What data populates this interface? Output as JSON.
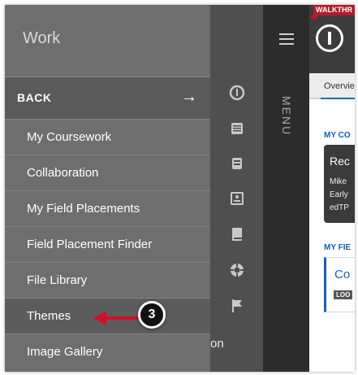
{
  "drawer": {
    "title": "Work",
    "back_label": "BACK",
    "back_arrow": "→",
    "items": [
      {
        "label": "My Coursework"
      },
      {
        "label": "Collaboration"
      },
      {
        "label": "My Field Placements"
      },
      {
        "label": "Field Placement Finder"
      },
      {
        "label": "File Library"
      },
      {
        "label": "Themes",
        "active": true
      },
      {
        "label": "Image Gallery"
      }
    ],
    "partial_text": "on"
  },
  "rail": {
    "icons": [
      "logo-icon",
      "inbox-icon",
      "briefcase-icon",
      "contact-card-icon",
      "book-icon",
      "lifebuoy-icon",
      "flag-icon"
    ]
  },
  "menu_strip": {
    "label": "MENU"
  },
  "content": {
    "walkthrough_tag": "WALKTHR",
    "tab_overview": "Overvie",
    "section1": "MY CO",
    "card1_title": "Rec",
    "card1_lines": [
      "Mike",
      "Early",
      "edTP"
    ],
    "section2": "MY FIE",
    "card2_title": "Co",
    "card2_badge": "LOO"
  },
  "callout": {
    "number": "3",
    "color": "#d0102a"
  }
}
